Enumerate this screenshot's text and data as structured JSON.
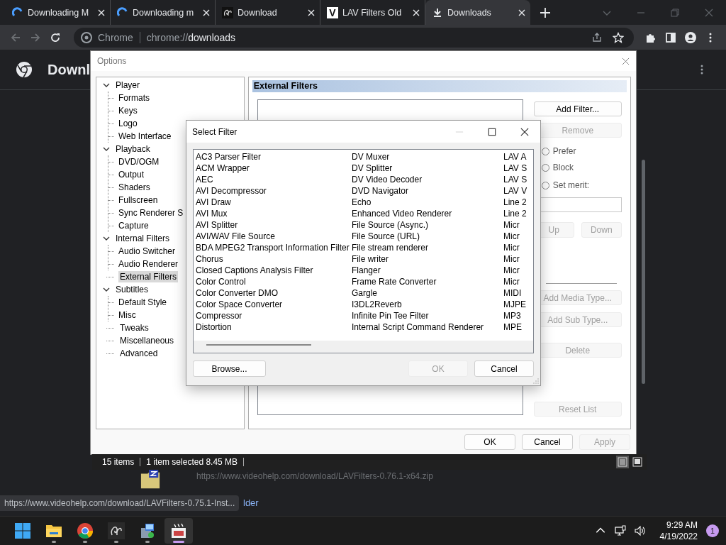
{
  "browser": {
    "tabs": [
      {
        "title": "Downloading M",
        "kind": "spinner",
        "selected": false
      },
      {
        "title": "Downloading m",
        "kind": "spinner",
        "selected": false
      },
      {
        "title": "Download",
        "kind": "script",
        "selected": false
      },
      {
        "title": "LAV Filters Old",
        "kind": "letter",
        "icon_text": "V",
        "selected": false
      },
      {
        "title": "Downloads",
        "kind": "download",
        "selected": true
      }
    ],
    "address": {
      "site_label": "Chrome",
      "url_scheme": "chrome://",
      "url_host": "downloads"
    },
    "page_title": "Downl",
    "download": {
      "url": "https://www.videohelp.com/download/LAVFilters-0.76.1-x64.zip",
      "link": "lder"
    },
    "status_url": "https://www.videohelp.com/download/LAVFilters-0.75.1-Inst..."
  },
  "options": {
    "title": "Options",
    "tree": [
      {
        "label": "Player",
        "expanded": true,
        "selected": false,
        "children": [
          {
            "label": "Formats",
            "selected": false
          },
          {
            "label": "Keys",
            "selected": false
          },
          {
            "label": "Logo",
            "selected": false
          },
          {
            "label": "Web Interface",
            "selected": false
          }
        ]
      },
      {
        "label": "Playback",
        "expanded": true,
        "selected": false,
        "children": [
          {
            "label": "DVD/OGM",
            "selected": false
          },
          {
            "label": "Output",
            "selected": false
          },
          {
            "label": "Shaders",
            "selected": false
          },
          {
            "label": "Fullscreen",
            "selected": false
          },
          {
            "label": "Sync Renderer S",
            "selected": false
          },
          {
            "label": "Capture",
            "selected": false
          }
        ]
      },
      {
        "label": "Internal Filters",
        "expanded": true,
        "selected": false,
        "children": [
          {
            "label": "Audio Switcher",
            "selected": false
          },
          {
            "label": "Audio Renderer",
            "selected": false
          }
        ]
      },
      {
        "label": "External Filters",
        "selected": true
      },
      {
        "label": "Subtitles",
        "expanded": true,
        "selected": false,
        "children": [
          {
            "label": "Default Style",
            "selected": false
          },
          {
            "label": "Misc",
            "selected": false
          }
        ]
      },
      {
        "label": "Tweaks",
        "selected": false
      },
      {
        "label": "Miscellaneous",
        "selected": false
      },
      {
        "label": "Advanced",
        "selected": false
      }
    ],
    "panel_title": "External Filters",
    "filter_buttons": [
      {
        "label": "Add Filter...",
        "disabled": false
      },
      {
        "label": "Remove",
        "disabled": true
      }
    ],
    "radios": [
      {
        "label": "Prefer",
        "selected": false
      },
      {
        "label": "Block",
        "selected": false
      },
      {
        "label": "Set merit:",
        "selected": false
      }
    ],
    "move_buttons": [
      {
        "label": "Up",
        "disabled": true
      },
      {
        "label": "Down",
        "disabled": true
      }
    ],
    "type_buttons": [
      {
        "label": "Add Media Type...",
        "disabled": true
      },
      {
        "label": "Add Sub Type...",
        "disabled": true
      },
      {
        "label": "Delete",
        "disabled": true
      }
    ],
    "reset_button": {
      "label": "Reset List",
      "disabled": true
    },
    "footer_buttons": [
      {
        "label": "OK",
        "disabled": false
      },
      {
        "label": "Cancel",
        "disabled": false
      },
      {
        "label": "Apply",
        "disabled": true
      }
    ]
  },
  "explorer_status": {
    "items": [
      "15 items",
      "1 item selected  8.45 MB"
    ],
    "views": [
      {
        "kind": "details",
        "selected": true
      },
      {
        "kind": "tiles",
        "selected": false
      }
    ]
  },
  "select_filter": {
    "title": "Select Filter",
    "columns": [
      [
        "AC3 Parser Filter",
        "ACM Wrapper",
        "AEC",
        "AVI Decompressor",
        "AVI Draw",
        "AVI Mux",
        "AVI Splitter",
        "AVI/WAV File Source",
        "BDA MPEG2 Transport Information Filter",
        "Chorus",
        "Closed Captions Analysis Filter",
        "Color Control",
        "Color Converter DMO",
        "Color Space Converter",
        "Compressor",
        "Distortion"
      ],
      [
        "DV Muxer",
        "DV Splitter",
        "DV Video Decoder",
        "DVD Navigator",
        "Echo",
        "Enhanced Video Renderer",
        "File Source (Async.)",
        "File Source (URL)",
        "File stream renderer",
        "File writer",
        "Flanger",
        "Frame Rate Converter",
        "Gargle",
        "I3DL2Reverb",
        "Infinite Pin Tee Filter",
        "Internal Script Command Renderer"
      ],
      [
        "LAV A",
        "LAV S",
        "LAV S",
        "LAV V",
        "Line 2",
        "Line 2",
        "Micr",
        "Micr",
        "Micr",
        "Micr",
        "Micr",
        "Micr",
        "MIDI",
        "MJPE",
        "MP3",
        "MPE"
      ]
    ],
    "buttons": [
      {
        "label": "Browse...",
        "disabled": false
      },
      {
        "label": "OK",
        "disabled": true
      },
      {
        "label": "Cancel",
        "disabled": false
      }
    ]
  },
  "taskbar": {
    "apps": [
      {
        "kind": "start",
        "running": false,
        "active": false
      },
      {
        "kind": "folder",
        "running": true,
        "active": false
      },
      {
        "kind": "browser",
        "running": true,
        "active": false
      },
      {
        "kind": "script",
        "running": true,
        "active": false
      },
      {
        "kind": "installer",
        "running": true,
        "active": false
      },
      {
        "kind": "clapper",
        "running": true,
        "active": true
      }
    ],
    "time": "9:29 AM",
    "date": "4/19/2022",
    "notifications": "1"
  }
}
